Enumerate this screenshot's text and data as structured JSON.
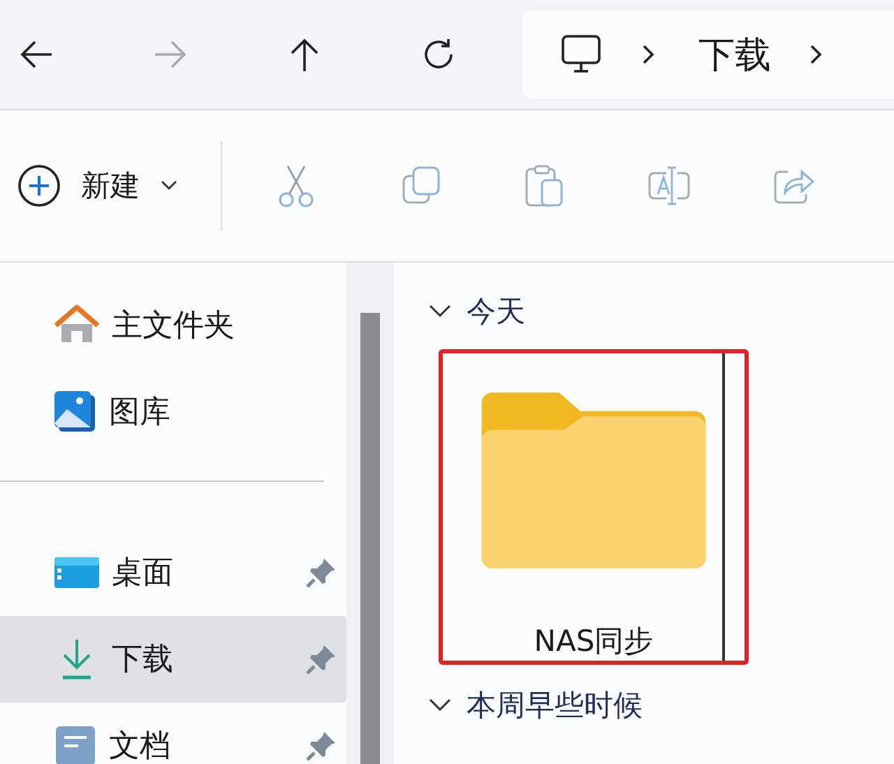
{
  "navigation": {
    "forward_enabled": false
  },
  "address_bar": {
    "crumbs": [
      "下载"
    ]
  },
  "toolbar": {
    "new_label": "新建"
  },
  "sidebar": {
    "groups": [
      [
        {
          "label": "主文件夹",
          "kind": "home",
          "pinned": false,
          "selected": false
        },
        {
          "label": "图库",
          "kind": "gallery",
          "pinned": false,
          "selected": false
        }
      ],
      [
        {
          "label": "桌面",
          "kind": "desktop",
          "pinned": true,
          "selected": false
        },
        {
          "label": "下载",
          "kind": "downloads",
          "pinned": true,
          "selected": true
        },
        {
          "label": "文档",
          "kind": "documents",
          "pinned": true,
          "selected": false
        }
      ]
    ]
  },
  "content": {
    "groups": [
      {
        "title": "今天",
        "expanded": true,
        "items": [
          {
            "name": "NAS同步",
            "highlighted": true
          }
        ]
      },
      {
        "title": "本周早些时候",
        "expanded": true
      }
    ]
  }
}
